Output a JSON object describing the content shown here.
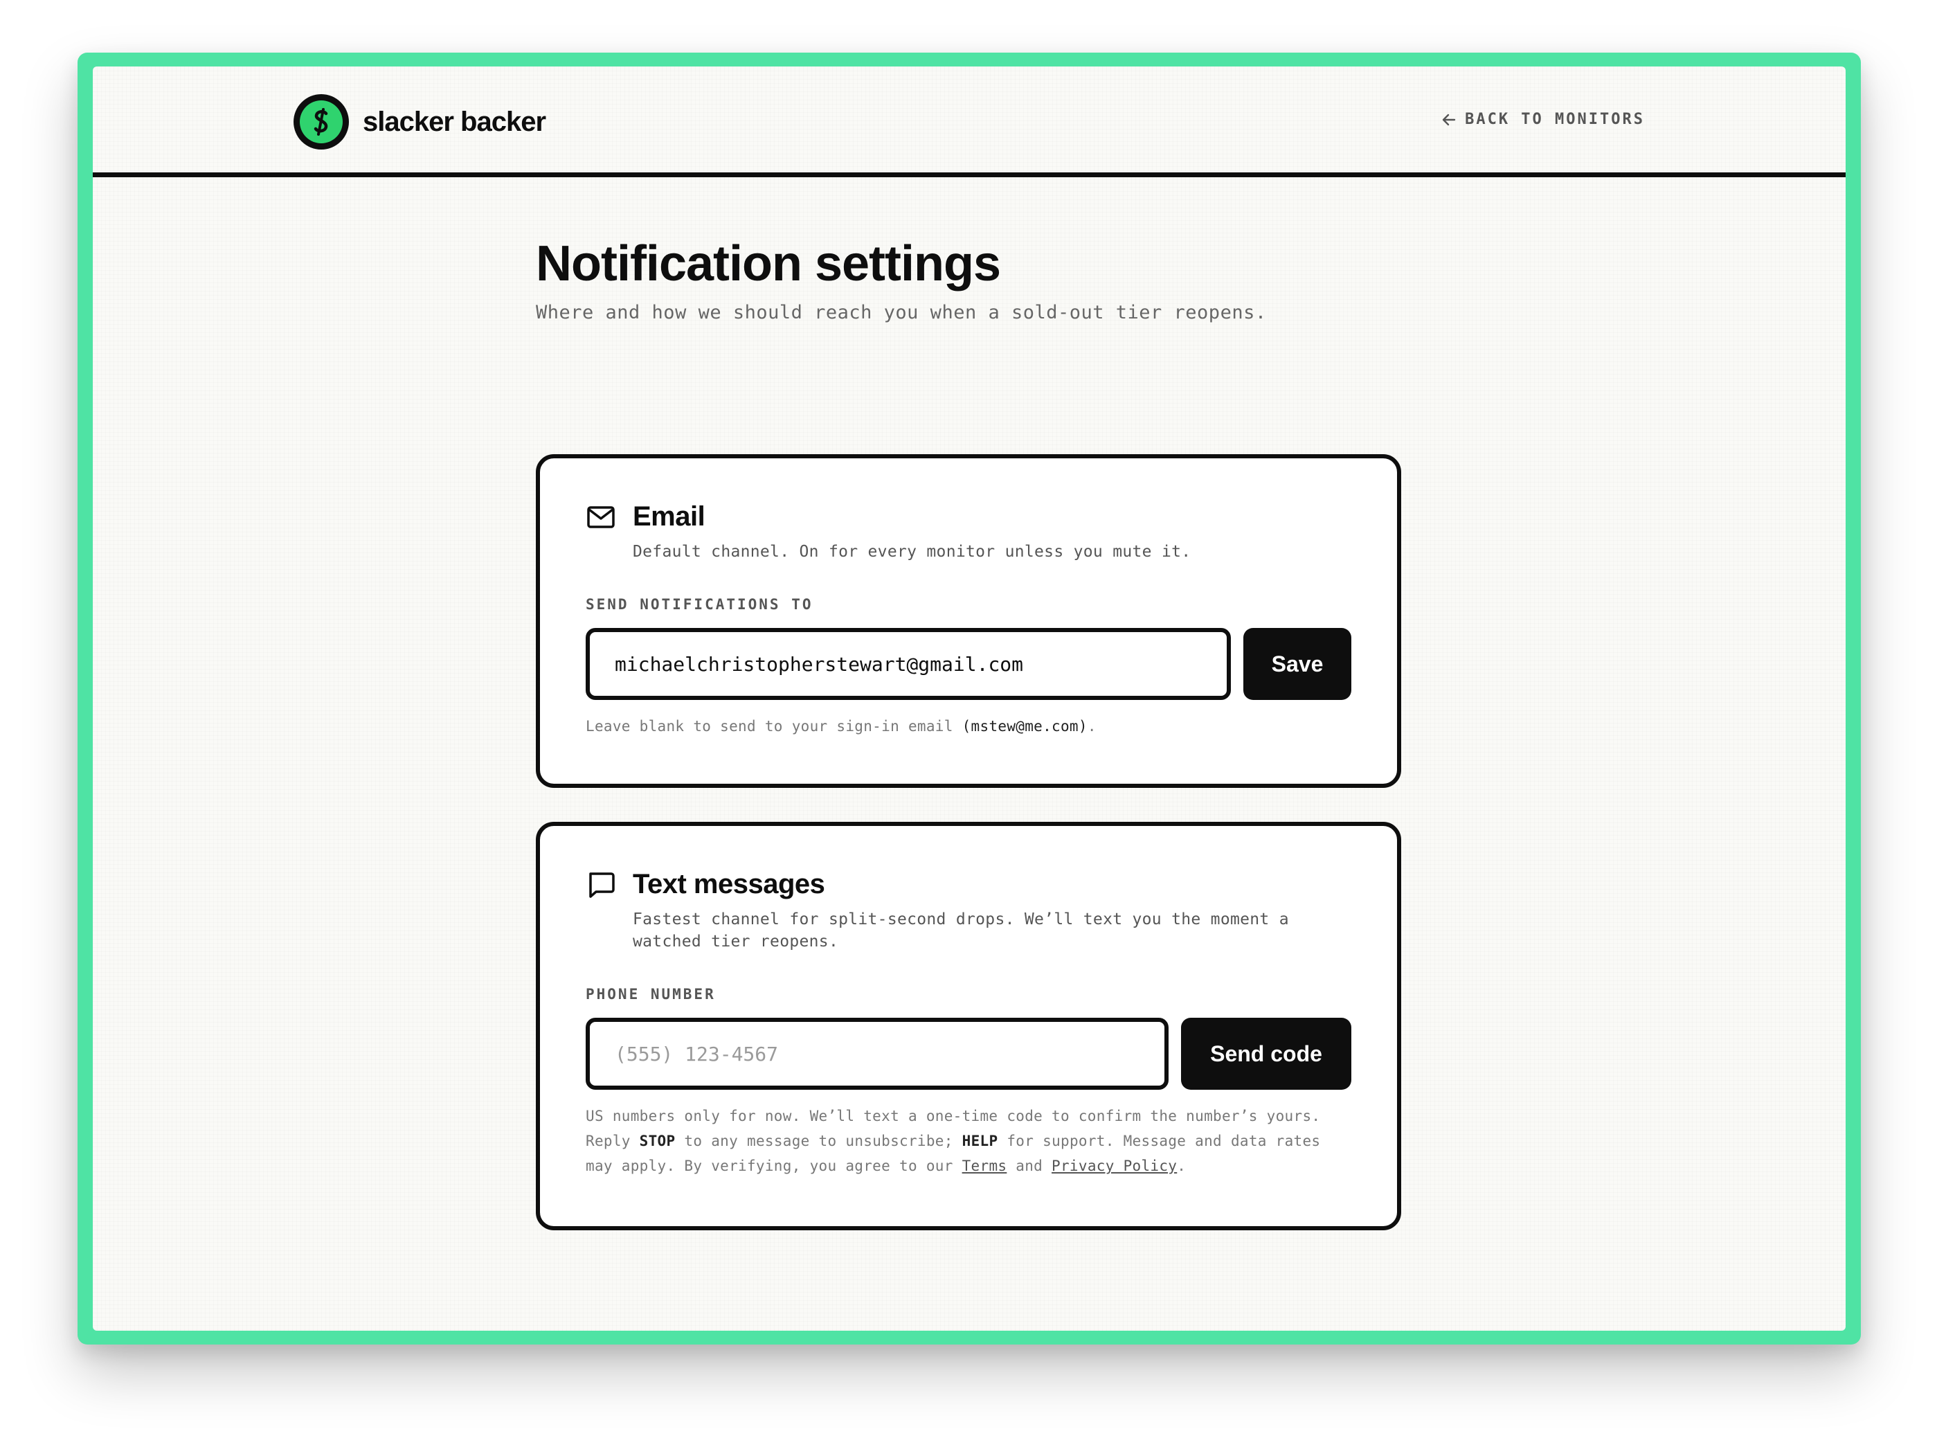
{
  "brand": {
    "name": "slacker backer",
    "logo_letter": "S"
  },
  "header": {
    "back_label": "BACK TO MONITORS"
  },
  "page": {
    "title": "Notification settings",
    "subtitle": "Where and how we should reach you when a sold-out tier reopens."
  },
  "email_card": {
    "title": "Email",
    "description": "Default channel. On for every monitor unless you mute it.",
    "field_label": "SEND NOTIFICATIONS TO",
    "input_value": "michaelchristopherstewart@gmail.com",
    "button_label": "Save",
    "hint_prefix": "Leave blank to send to your sign-in email ",
    "hint_email": "(mstew@me.com)",
    "hint_suffix": "."
  },
  "sms_card": {
    "title": "Text messages",
    "description": "Fastest channel for split-second drops. We’ll text you the moment a watched tier reopens.",
    "field_label": "PHONE NUMBER",
    "input_placeholder": "(555) 123-4567",
    "button_label": "Send code",
    "hint_part1": "US numbers only for now. We’ll text a one-time code to confirm the number’s yours. Reply ",
    "hint_stop": "STOP",
    "hint_part2": " to any message to unsubscribe; ",
    "hint_help": "HELP",
    "hint_part3": " for support. Message and data rates may apply. By verifying, you agree to our ",
    "terms_label": "Terms",
    "hint_and": " and ",
    "privacy_label": "Privacy Policy",
    "hint_end": "."
  },
  "colors": {
    "frame": "#4fe3a4",
    "logo_green": "#2fd36e",
    "ink": "#0e0e0e",
    "background": "#fafaf7"
  },
  "icons": {
    "logo": "dollar-s-logo-icon",
    "back": "arrow-left-icon",
    "email": "envelope-icon",
    "sms": "chat-bubble-icon"
  }
}
